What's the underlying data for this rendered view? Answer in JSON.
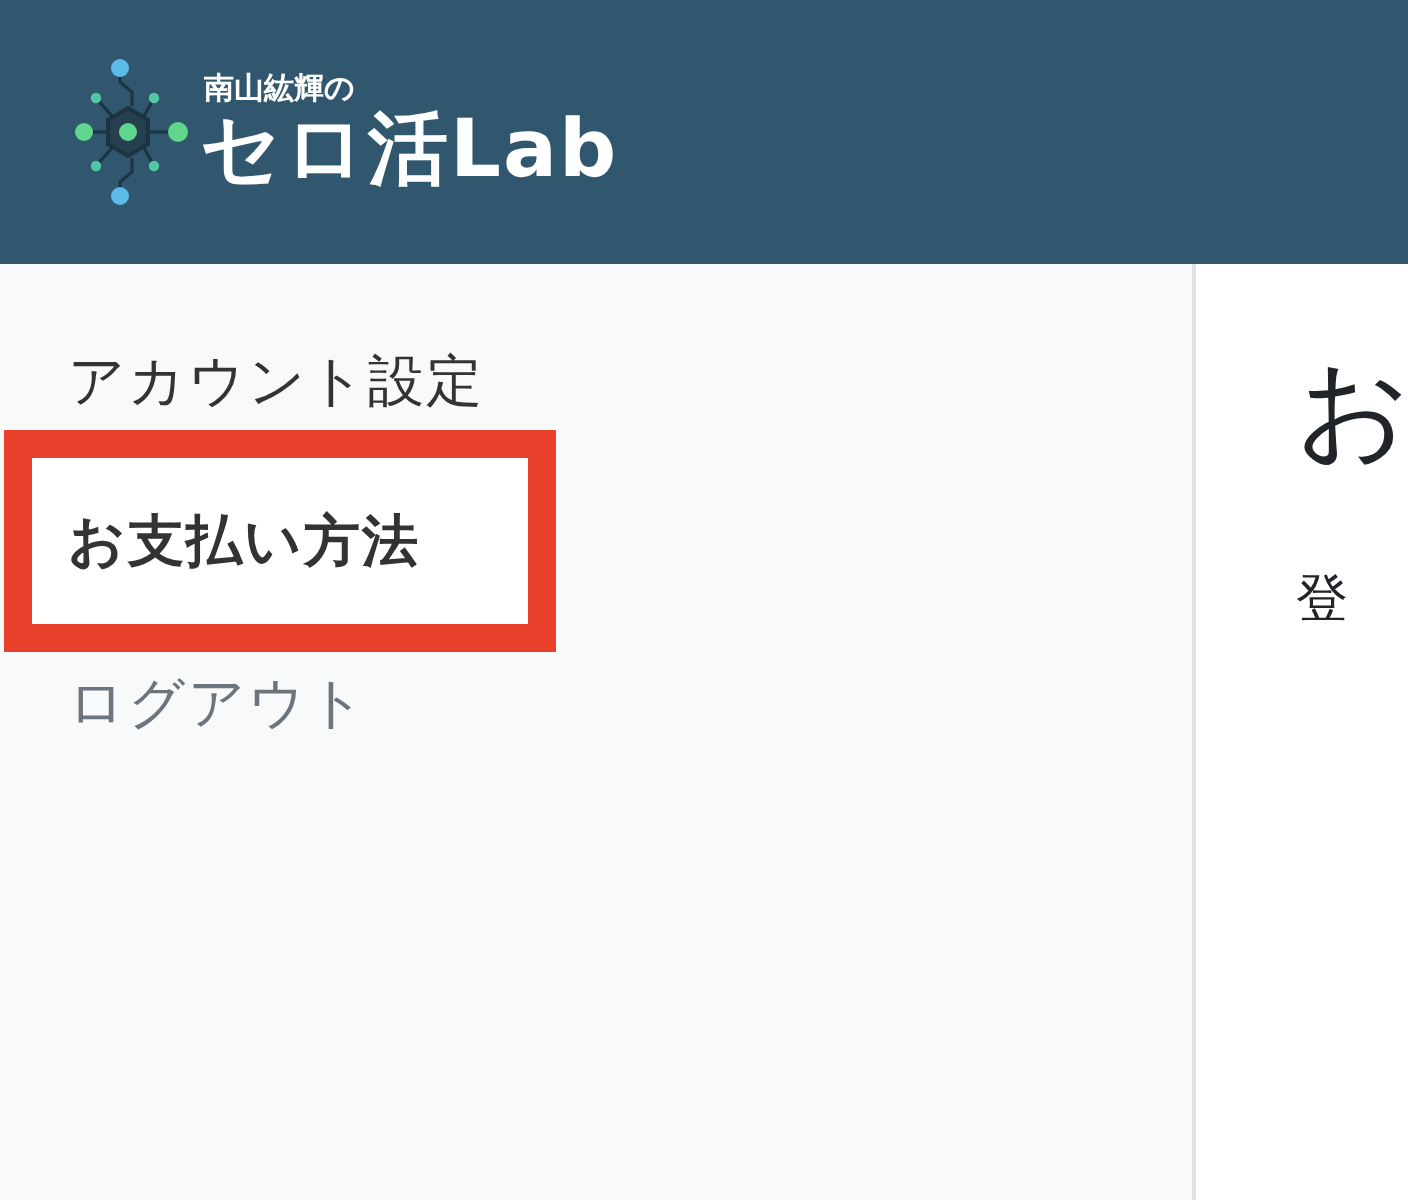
{
  "header": {
    "logo": {
      "byline": "南山紘輝の",
      "name": "セロ活Lab"
    }
  },
  "sidebar": {
    "items": [
      {
        "label": "アカウント設定",
        "selected": false,
        "muted": false,
        "highlighted": false
      },
      {
        "label": "お支払い方法",
        "selected": true,
        "muted": false,
        "highlighted": true
      },
      {
        "label": "ログアウト",
        "selected": false,
        "muted": true,
        "highlighted": false
      }
    ]
  },
  "main": {
    "heading": "お",
    "text": "登"
  }
}
